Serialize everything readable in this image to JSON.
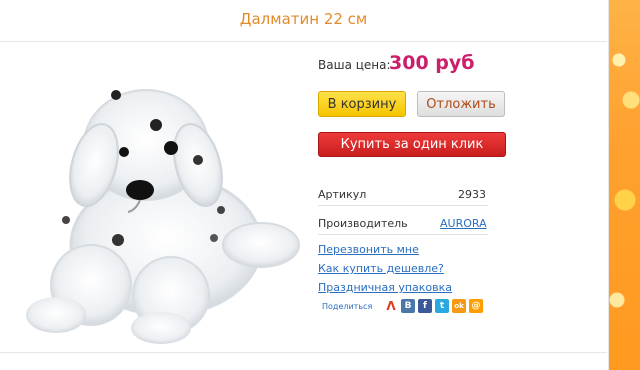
{
  "product": {
    "title": "Далматин 22 см",
    "price_label": "Ваша цена:",
    "price_value": "300 руб"
  },
  "buttons": {
    "cart": "В корзину",
    "defer": "Отложить",
    "one_click": "Купить за один клик"
  },
  "details": {
    "article_label": "Артикул",
    "article_value": "2933",
    "manufacturer_label": "Производитель",
    "manufacturer_value": "AURORA"
  },
  "links": {
    "callback": "Перезвонить мне",
    "cheaper": "Как купить дешевле?",
    "gift_wrap": "Праздничная упаковка"
  },
  "share": {
    "label": "Поделиться",
    "icons": [
      {
        "name": "odnoklassniki-red-icon",
        "glyph": "ᐱ",
        "color": "#ffffff",
        "fg": "#e03a1e"
      },
      {
        "name": "vkontakte-icon",
        "glyph": "В",
        "color": "#4a76a8"
      },
      {
        "name": "facebook-icon",
        "glyph": "f",
        "color": "#3b5998"
      },
      {
        "name": "twitter-icon",
        "glyph": "t",
        "color": "#29a9e1"
      },
      {
        "name": "odnoklassniki-icon",
        "glyph": "ok",
        "color": "#f59a12"
      },
      {
        "name": "mailru-icon",
        "glyph": "@",
        "color": "#ff9e00"
      }
    ]
  }
}
